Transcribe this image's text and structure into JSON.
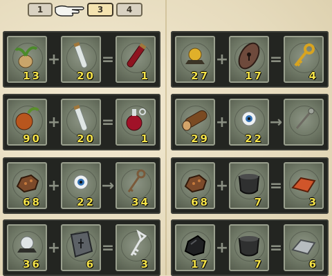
{
  "tabs": [
    {
      "label": "1",
      "active": false
    },
    {
      "label": "3",
      "active": true
    },
    {
      "label": "4",
      "active": false
    }
  ],
  "recipes": [
    {
      "a": {
        "icon": "bulb-plant-icon",
        "count": "13"
      },
      "op1": "+",
      "b": {
        "icon": "empty-vial-icon",
        "count": "20"
      },
      "op2": "=",
      "c": {
        "icon": "red-potion-vial-icon",
        "count": "1"
      }
    },
    {
      "a": {
        "icon": "gold-ore-icon",
        "count": "27"
      },
      "op1": "+",
      "b": {
        "icon": "keyhole-plate-icon",
        "count": "17"
      },
      "op2": "=",
      "c": {
        "icon": "golden-key-icon",
        "count": "4"
      }
    },
    {
      "a": {
        "icon": "gourd-fruit-icon",
        "count": "90"
      },
      "op1": "+",
      "b": {
        "icon": "empty-vial-icon",
        "count": "20"
      },
      "op2": "=",
      "c": {
        "icon": "red-potion-flask-icon",
        "count": "1"
      }
    },
    {
      "a": {
        "icon": "wood-log-icon",
        "count": "29"
      },
      "op1": "+",
      "b": {
        "icon": "eyeball-icon",
        "count": "22"
      },
      "op2": "→",
      "c": {
        "icon": "staff-wand-icon",
        "count": ""
      }
    },
    {
      "a": {
        "icon": "copper-ore-icon",
        "count": "68"
      },
      "op1": "+",
      "b": {
        "icon": "eyeball-icon",
        "count": "22"
      },
      "op2": "→",
      "c": {
        "icon": "bronze-key-icon",
        "count": "34"
      }
    },
    {
      "a": {
        "icon": "copper-ore-icon",
        "count": "68"
      },
      "op1": "+",
      "b": {
        "icon": "cauldron-icon",
        "count": "7"
      },
      "op2": "=",
      "c": {
        "icon": "copper-ingot-icon",
        "count": "3"
      }
    },
    {
      "a": {
        "icon": "silver-ore-icon",
        "count": "36"
      },
      "op1": "+",
      "b": {
        "icon": "stone-tablet-icon",
        "count": "6"
      },
      "op2": "=",
      "c": {
        "icon": "silver-key-icon",
        "count": "3"
      }
    },
    {
      "a": {
        "icon": "coal-lump-icon",
        "count": "17"
      },
      "op1": "+",
      "b": {
        "icon": "cauldron-icon",
        "count": "7"
      },
      "op2": "=",
      "c": {
        "icon": "silver-ingot-icon",
        "count": "6"
      }
    }
  ]
}
